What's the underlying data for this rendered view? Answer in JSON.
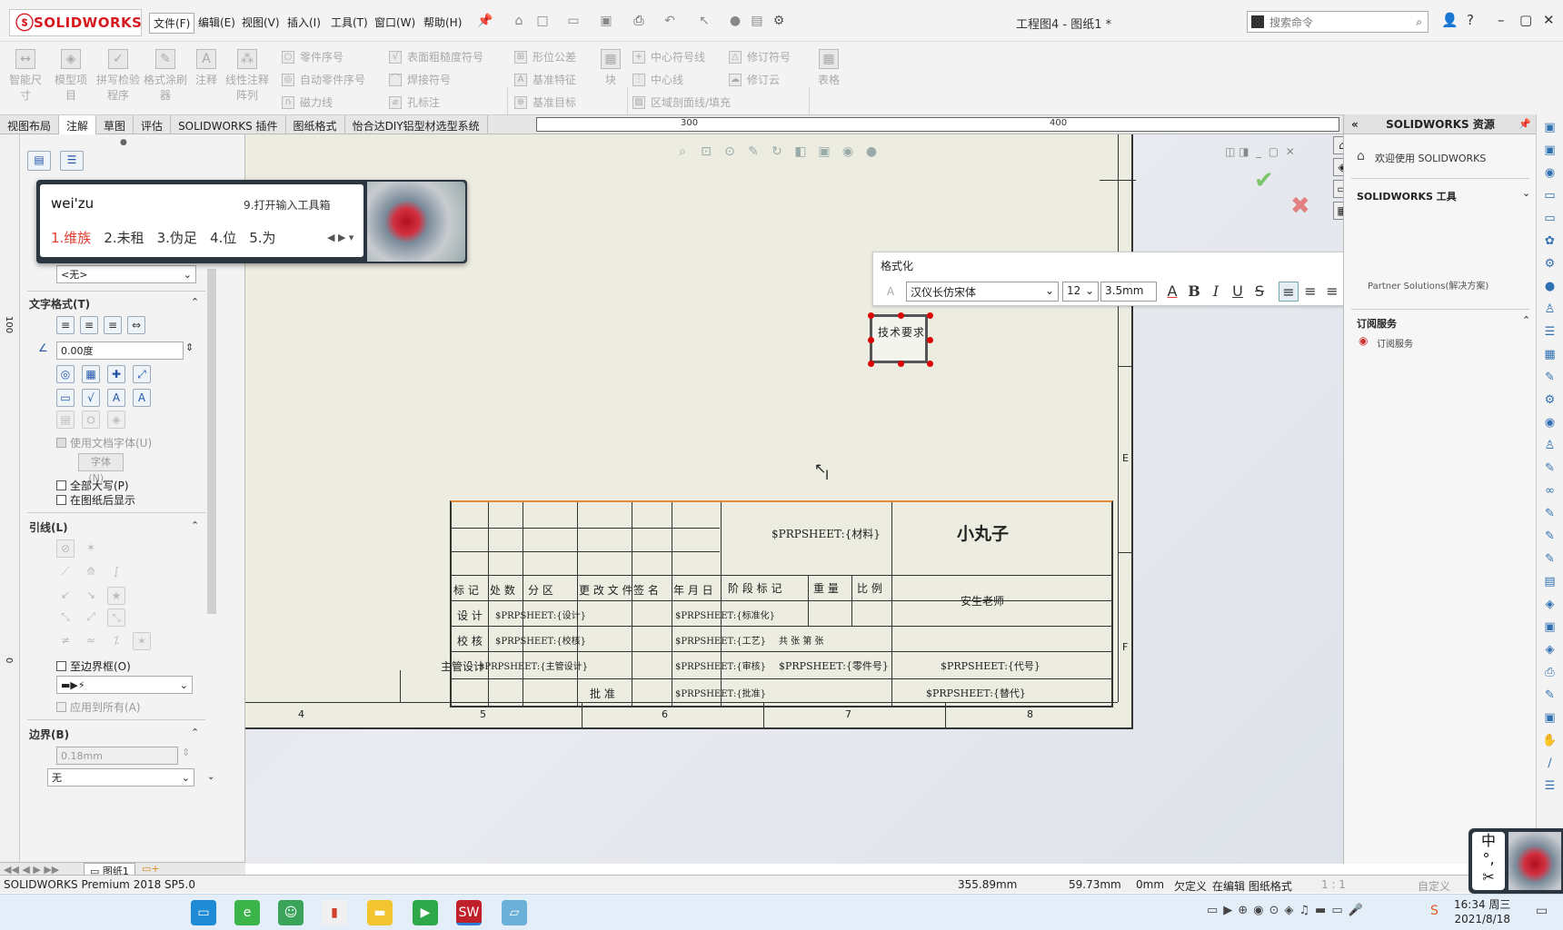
{
  "app": {
    "logo_text": "SOLIDWORKS",
    "window_title": "工程图4 - 图纸1 *"
  },
  "menu": [
    "文件(F)",
    "编辑(E)",
    "视图(V)",
    "插入(I)",
    "工具(T)",
    "窗口(W)",
    "帮助(H)"
  ],
  "search": {
    "placeholder": "搜索命令"
  },
  "ribbon": {
    "big": [
      "智能尺寸",
      "模型项目",
      "拼写检验程序",
      "格式涂刷器",
      "注释",
      "线性注释阵列",
      "块",
      "表格"
    ],
    "col1": [
      "零件序号",
      "自动零件序号",
      "磁力线"
    ],
    "col2": [
      "表面粗糙度符号",
      "焊接符号",
      "孔标注"
    ],
    "col3": [
      "形位公差",
      "基准特征",
      "基准目标"
    ],
    "col4": [
      "中心符号线",
      "中心线",
      "区域剖面线/填充"
    ],
    "col5": [
      "修订符号",
      "修订云"
    ]
  },
  "tabs": [
    "视图布局",
    "注解",
    "草图",
    "评估",
    "SOLIDWORKS 插件",
    "图纸格式",
    "怡合达DIY铝型材选型系统"
  ],
  "ruler": {
    "top_ticks": [
      "300",
      "400"
    ],
    "left_ticks": [
      "100",
      "0"
    ]
  },
  "ime": {
    "code": "wei'zu",
    "toolbox": "9.打开输入工具箱",
    "candidates": [
      "1.维族",
      "2.未租",
      "3.伪足",
      "4.位",
      "5.为"
    ]
  },
  "left_panel": {
    "style_select": "<无>",
    "text_format_title": "文字格式(T)",
    "angle": "0.00度",
    "use_doc_font": "使用文档字体(U)",
    "font_btn": "字体(N)...",
    "all_caps": "全部大写(P)",
    "behind_sheet": "在图纸后显示",
    "leader_title": "引线(L)",
    "to_border": "至边界框(O)",
    "apply_all": "应用到所有(A)",
    "border_title": "边界(B)",
    "border_width": "0.18mm",
    "border_style": "无",
    "sheet_tab": "图纸1"
  },
  "format_bar": {
    "title": "格式化",
    "font": "汉仪长仿宋体",
    "size": "12",
    "height": "3.5mm",
    "bold": "B",
    "italic": "I",
    "underline": "U",
    "strike": "S"
  },
  "note": {
    "text": "技术要求"
  },
  "title_block": {
    "material": "$PRPSHEET:{材料}",
    "company": "小丸子",
    "headers": [
      "标 记",
      "处 数",
      "分 区",
      "更 改 文 件 号",
      "签 名",
      "年 月 日"
    ],
    "stage_headers": [
      "阶 段 标 记",
      "重 量",
      "比 例"
    ],
    "rows": [
      {
        "label": "设 计",
        "v1": "$PRPSHEET:{设计}",
        "v2": "$PRPSHEET:{标准化}"
      },
      {
        "label": "校 核",
        "v1": "$PRPSHEET:{校核}",
        "v2": "$PRPSHEET:{工艺}"
      },
      {
        "label": "主管设计",
        "v1": "$PRPSHEET:{主管设计}",
        "v2": "$PRPSHEET:{审核}"
      },
      {
        "label": "批 准",
        "v1": "",
        "v2": "$PRPSHEET:{批准}"
      }
    ],
    "teacher": "安生老师",
    "part_no": "$PRPSHEET:{零件号}",
    "code": "$PRPSHEET:{代号}",
    "replace": "$PRPSHEET:{替代}",
    "sheet_info": "共 张 第 张",
    "col_labels": [
      "4",
      "5",
      "6",
      "7",
      "8"
    ],
    "row_labels": [
      "E",
      "F"
    ]
  },
  "resources": {
    "title": "SOLIDWORKS 资源",
    "welcome": "欢迎使用 SOLIDWORKS",
    "tools": "SOLIDWORKS 工具",
    "partner": "Partner Solutions(解决方案)",
    "subs_title": "订阅服务",
    "subs_item": "订阅服务"
  },
  "status": {
    "version": "SOLIDWORKS Premium 2018 SP5.0",
    "x": "355.89mm",
    "y": "59.73mm",
    "z": "0mm",
    "state": "欠定义",
    "mode": "在编辑 图纸格式",
    "scale": "1 : 1",
    "custom": "自定义"
  },
  "clock": {
    "time": "16:34 周三",
    "date": "2021/8/18"
  },
  "ime_badge": {
    "lang": "中",
    "punct": "°,",
    "mode": "✂"
  },
  "colors": {
    "accent": "#d71920",
    "sheet": "#ecece1",
    "selection": "#e13b2e"
  }
}
